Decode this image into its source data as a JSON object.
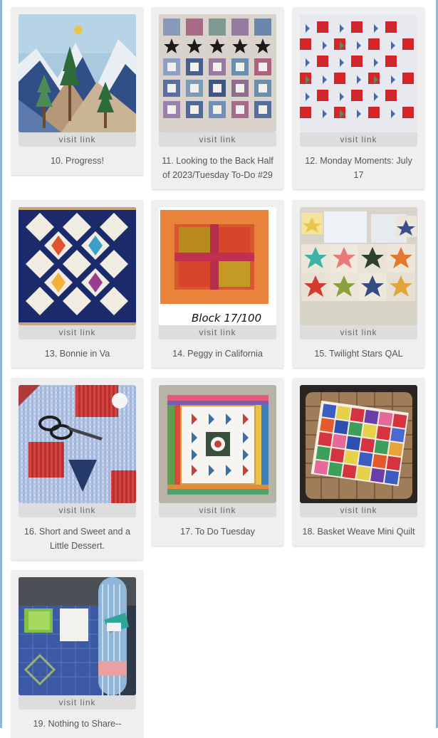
{
  "visit_label": "visit link",
  "items": [
    {
      "caption": "10. Progress!"
    },
    {
      "caption": "11. Looking to the Back Half of 2023/Tuesday To-Do #29"
    },
    {
      "caption": "12. Monday Moments: July 17"
    },
    {
      "caption": "13. Bonnie in Va"
    },
    {
      "caption": "14. Peggy in California",
      "image_text": "Block 17/100"
    },
    {
      "caption": "15. Twilight Stars QAL"
    },
    {
      "caption": "16. Short and Sweet and a Little Dessert."
    },
    {
      "caption": "17. To Do Tuesday"
    },
    {
      "caption": "18. Basket Weave Mini Quilt"
    },
    {
      "caption": "19. Nothing to Share--"
    }
  ]
}
